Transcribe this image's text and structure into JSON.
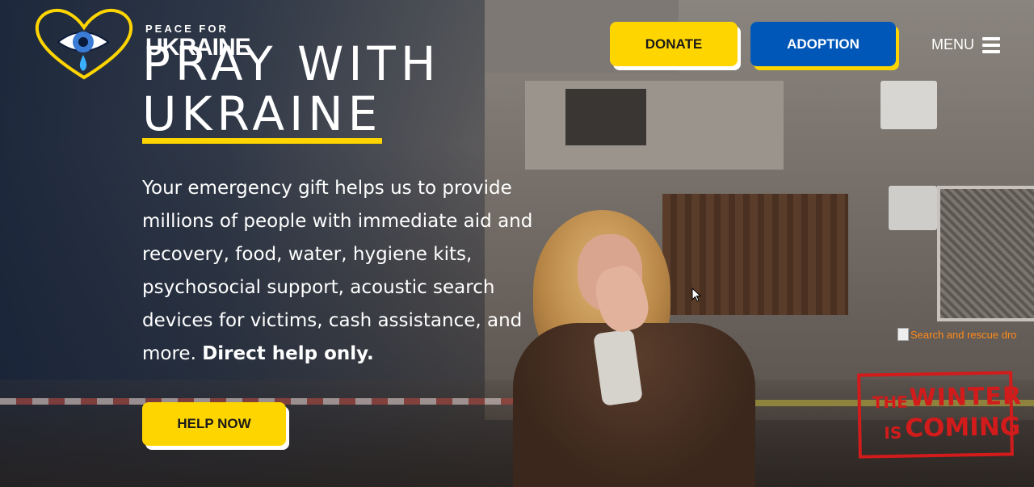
{
  "brand": {
    "line1": "PEACE FOR",
    "line2": "UKRAINE",
    "colors": {
      "yellow": "#ffd500",
      "blue": "#0057b8"
    }
  },
  "header": {
    "donate_label": "DONATE",
    "adoption_label": "ADOPTION",
    "menu_label": "MENU",
    "menu_icon": "hamburger-icon"
  },
  "hero": {
    "title_line1": "PRAY WITH",
    "title_line2": "UKRAINE",
    "description": "Your emergency gift helps us to provide millions of people with immediate aid and recovery, food, water, hygiene kits, psychosocial support, acoustic search devices for victims, cash assistance, and more.",
    "description_bold": "Direct help only.",
    "cta_label": "HELP NOW"
  },
  "side": {
    "broken_image_alt": "Search and rescue dro",
    "stamp": {
      "word1": "THE",
      "word2": "WINTER",
      "word3": "IS",
      "word4": "COMING"
    }
  }
}
